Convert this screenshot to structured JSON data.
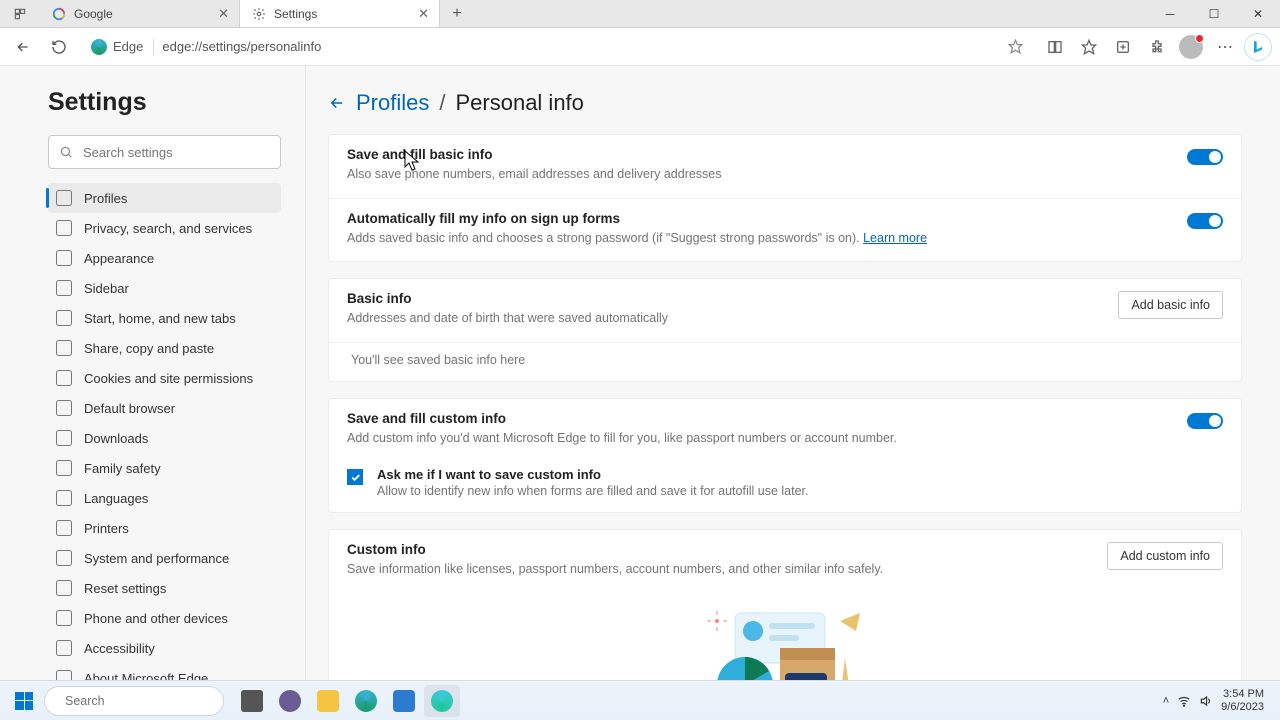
{
  "tabs": [
    {
      "label": "Google"
    },
    {
      "label": "Settings"
    }
  ],
  "toolbar": {
    "edge_label": "Edge",
    "url": "edge://settings/personalinfo"
  },
  "sidebar": {
    "title": "Settings",
    "search_placeholder": "Search settings",
    "items": [
      "Profiles",
      "Privacy, search, and services",
      "Appearance",
      "Sidebar",
      "Start, home, and new tabs",
      "Share, copy and paste",
      "Cookies and site permissions",
      "Default browser",
      "Downloads",
      "Family safety",
      "Languages",
      "Printers",
      "System and performance",
      "Reset settings",
      "Phone and other devices",
      "Accessibility",
      "About Microsoft Edge"
    ]
  },
  "breadcrumb": {
    "parent": "Profiles",
    "sep": "/",
    "current": "Personal info"
  },
  "s1": {
    "r1_title": "Save and fill basic info",
    "r1_desc": "Also save phone numbers, email addresses and delivery addresses",
    "r2_title": "Automatically fill my info on sign up forms",
    "r2_desc": "Adds saved basic info and chooses a strong password (if \"Suggest strong passwords\" is on). ",
    "learn_more": "Learn more"
  },
  "s2": {
    "title": "Basic info",
    "desc": "Addresses and date of birth that were saved automatically",
    "btn": "Add basic info",
    "empty": "You'll see saved basic info here"
  },
  "s3": {
    "title": "Save and fill custom info",
    "desc": "Add custom info you'd want Microsoft Edge to fill for you, like passport numbers or account number.",
    "chk_title": "Ask me if I want to save custom info",
    "chk_desc": "Allow to identify new info when forms are filled and save it for autofill use later."
  },
  "s4": {
    "title": "Custom info",
    "desc": "Save information like licenses, passport numbers, account numbers, and other similar info safely.",
    "btn": "Add custom info"
  },
  "taskbar": {
    "search_placeholder": "Search",
    "time": "3:54 PM",
    "date": "9/6/2023"
  }
}
